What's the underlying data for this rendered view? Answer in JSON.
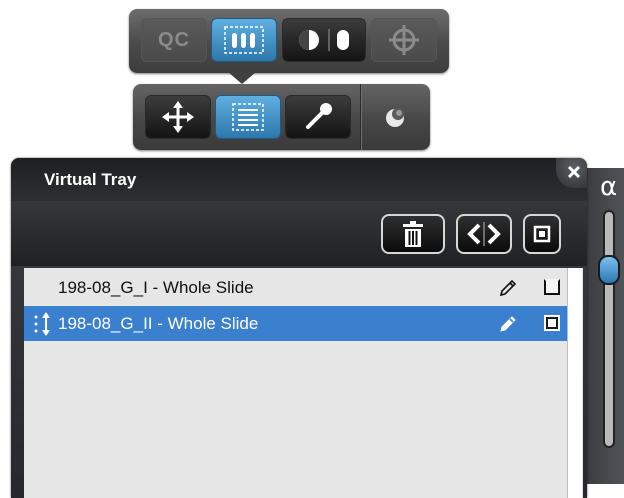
{
  "toolbar_top": {
    "qc_label": "QC",
    "buttons": [
      {
        "icon": "qc-icon",
        "state": "disabled"
      },
      {
        "icon": "rack-select-icon",
        "state": "active"
      },
      {
        "icon": "contrast-split-icon",
        "state": "normal"
      },
      {
        "icon": "crosshair-icon",
        "state": "disabled"
      }
    ]
  },
  "toolbar_sub": {
    "buttons": [
      {
        "icon": "move-arrows-icon",
        "state": "normal"
      },
      {
        "icon": "list-select-icon",
        "state": "active"
      },
      {
        "icon": "pipette-icon",
        "state": "normal"
      },
      {
        "icon": "sphere-icon",
        "state": "normal"
      }
    ]
  },
  "panel": {
    "title": "Virtual Tray",
    "close_icon": "close-icon",
    "toolbar_icons": [
      "trash-icon",
      "prev-next-icon",
      "checkbox-icon"
    ]
  },
  "slides": [
    {
      "label": "198-08_G_I - Whole Slide",
      "selected": false,
      "checked": false
    },
    {
      "label": "198-08_G_II - Whole Slide",
      "selected": true,
      "checked": true
    }
  ],
  "opacity": {
    "label": "α",
    "value": 0.8
  },
  "colors": {
    "accent": "#3b7fcf",
    "active_button": "#3f8fc6",
    "panel": "#2d2f32"
  }
}
